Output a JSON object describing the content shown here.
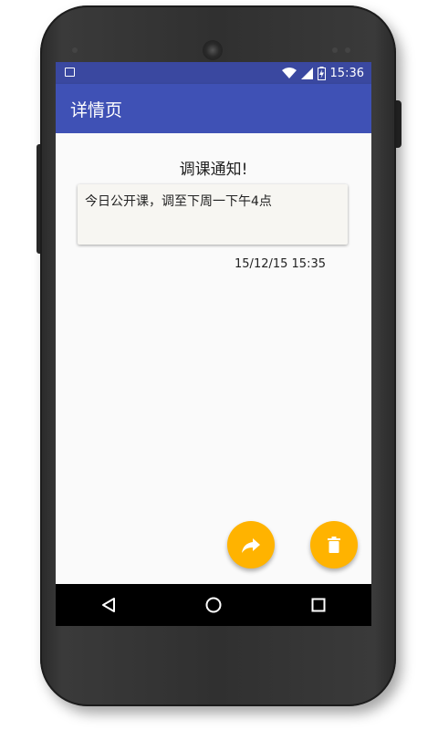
{
  "statusbar": {
    "time": "15:36",
    "icons": [
      "image-notification-icon",
      "wifi-icon",
      "signal-icon",
      "battery-charging-icon"
    ]
  },
  "appbar": {
    "title": "详情页"
  },
  "notice": {
    "title": "调课通知!",
    "body": "今日公开课，调至下周一下午4点",
    "timestamp": "15/12/15 15:35"
  },
  "actions": {
    "share_icon": "share-forward-icon",
    "delete_icon": "trash-icon"
  },
  "navbar": {
    "buttons": [
      "back-icon",
      "home-icon",
      "recents-icon"
    ]
  },
  "colors": {
    "primary": "#3f51b5",
    "primary_dark": "#3a48a0",
    "accent": "#ffb300",
    "background": "#fafafa"
  }
}
